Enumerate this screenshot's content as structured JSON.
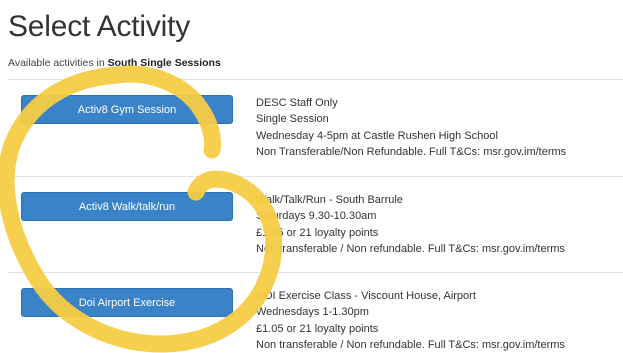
{
  "page": {
    "title": "Select Activity",
    "subtitle_prefix": "Available activities in ",
    "subtitle_location": "South Single Sessions"
  },
  "activities": [
    {
      "button_label": "Activ8 Gym Session",
      "details": [
        "DESC Staff Only",
        "Single Session",
        "Wednesday 4-5pm at Castle Rushen High School",
        "Non Transferable/Non Refundable. Full T&Cs: msr.gov.im/terms"
      ]
    },
    {
      "button_label": "Activ8 Walk/talk/run",
      "details": [
        "Walk/Talk/Run - South Barrule",
        "Saturdays 9.30-10.30am",
        "£1.05 or 21 loyalty points",
        "Non transferable / Non refundable. Full T&Cs: msr.gov.im/terms"
      ]
    },
    {
      "button_label": "Doi Airport Exercise",
      "details": [
        "DOI Exercise Class - Viscount House, Airport",
        "Wednesdays 1-1.30pm",
        "£1.05 or 21 loyalty points",
        "Non transferable / Non refundable. Full T&Cs: msr.gov.im/terms"
      ]
    }
  ],
  "annotation": {
    "color": "#f6cc45"
  }
}
